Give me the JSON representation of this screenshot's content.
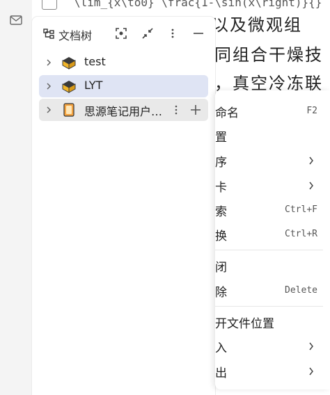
{
  "editor": {
    "formula": "\\lim_{x\\to0} \\frac{1-\\sin(x\\right)}{}",
    "lines": [
      "作物水性以及微观组",
      "同组合干燥技",
      "，真空冷冻联合"
    ],
    "visible_line_fragments": [
      "水性以及微观组",
      "同组合干燥技",
      "，真空冷冻联"
    ]
  },
  "tree": {
    "title": "文档树",
    "items": [
      {
        "label": "test"
      },
      {
        "label": "LYT"
      },
      {
        "label": "思源笔记用户…"
      }
    ]
  },
  "menu": {
    "items": [
      {
        "label": "命名",
        "shortcut": "F2"
      },
      {
        "label": "置"
      },
      {
        "label": "序"
      },
      {
        "label": "卡"
      },
      {
        "label": "索",
        "shortcut": "Ctrl+F"
      },
      {
        "label": "换",
        "shortcut": "Ctrl+R"
      },
      {
        "label": "闭"
      },
      {
        "label": "除",
        "shortcut": "Delete"
      },
      {
        "label": "开文件位置"
      },
      {
        "label": "入"
      },
      {
        "label": "出"
      }
    ]
  },
  "colors": {
    "selected_row": "#dfe4f4",
    "hover_row": "#e9e9e9",
    "notebook_box": "#f0b429"
  }
}
